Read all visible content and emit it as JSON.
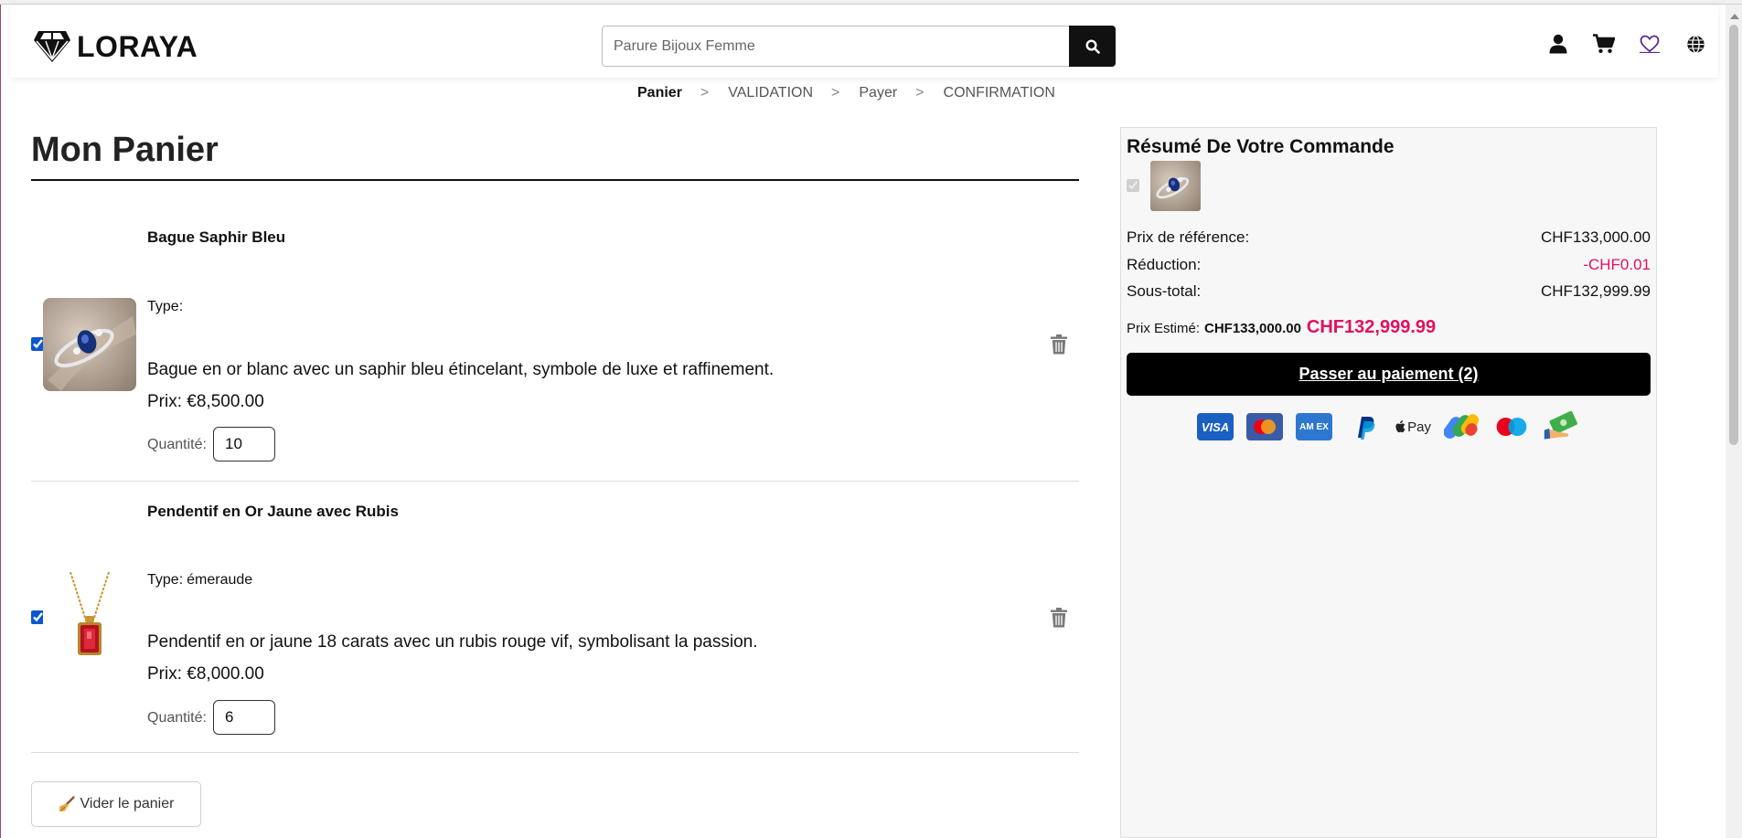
{
  "header": {
    "brand": "LORAYA",
    "search_placeholder": "Parure Bijoux Femme",
    "icons": [
      "user-icon",
      "cart-icon",
      "heart-icon",
      "globe-icon"
    ]
  },
  "steps": [
    {
      "label": "Panier",
      "active": true
    },
    {
      "label": "VALIDATION",
      "active": false
    },
    {
      "label": "Payer",
      "active": false
    },
    {
      "label": "CONFIRMATION",
      "active": false
    }
  ],
  "step_separator": ">",
  "cart": {
    "title": "Mon Panier",
    "type_label": "Type:",
    "qty_label": "Quantité:",
    "empty_button": "Vider le panier",
    "items": [
      {
        "name": "Bague Saphir Bleu",
        "type": "",
        "description": "Bague en or blanc avec un saphir bleu étincelant, symbole de luxe et raffinement.",
        "price": "Prix: €8,500.00",
        "quantity": "10",
        "checked": true
      },
      {
        "name": "Pendentif en Or Jaune avec Rubis",
        "type": "émeraude",
        "description": "Pendentif en or jaune 18 carats avec un rubis rouge vif, symbolisant la passion.",
        "price": "Prix: €8,000.00",
        "quantity": "6",
        "checked": true
      }
    ]
  },
  "summary": {
    "title": "Résumé De Votre Commande",
    "rows": [
      {
        "label": "Prix de référence:",
        "value": "CHF133,000.00"
      },
      {
        "label": "Réduction:",
        "value": "-CHF0.01"
      },
      {
        "label": "Sous-total:",
        "value": "CHF132,999.99"
      }
    ],
    "estimate_label": "Prix Estimé:",
    "estimate_old": "CHF133,000.00",
    "estimate_new": "CHF132,999.99",
    "pay_button": "Passer au paiement (2)",
    "payment_methods": [
      "VISA",
      "Mastercard",
      "AMEX",
      "PayPal",
      "Apple Pay",
      "Google Pay",
      "Maestro",
      "Cash"
    ],
    "visa_text": "VISA",
    "amex_text": "AM EX",
    "applepay_text": "Pay"
  },
  "colors": {
    "accent_pink": "#e0115f",
    "primary_black": "#000000",
    "checkbox_blue": "#0b57d0",
    "summary_bg": "#f7f7f7"
  }
}
